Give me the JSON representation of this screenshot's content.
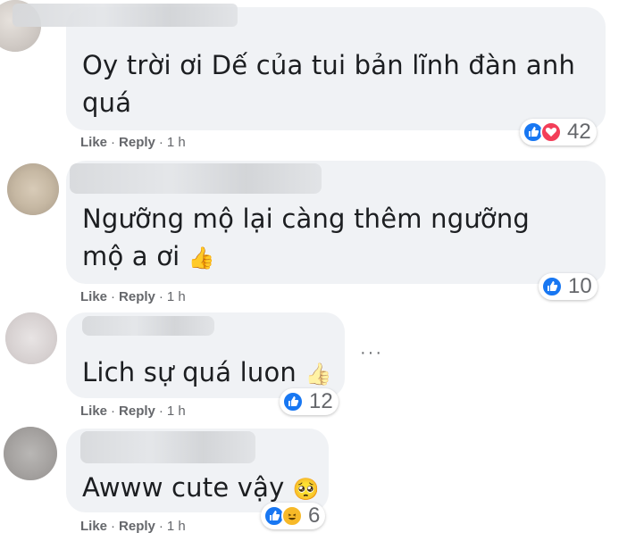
{
  "comments": [
    {
      "text_line1": "Oy trời ơi Dế của tui bản lĩnh đàn anh",
      "text_line2": "quá",
      "like": "Like",
      "reply": "Reply",
      "sep": "·",
      "time": "1 h",
      "reaction_count": "42",
      "reactions": [
        "like-icon",
        "love-icon"
      ]
    },
    {
      "text_line1": "Ngưỡng mộ lại càng thêm ngưỡng",
      "text_line2": "mộ a ơi",
      "emoji": "👍",
      "like": "Like",
      "reply": "Reply",
      "sep": "·",
      "time": "1 h",
      "reaction_count": "10",
      "reactions": [
        "like-icon"
      ]
    },
    {
      "text_line1": "Lich sự quá luon",
      "emoji": "👍",
      "like": "Like",
      "reply": "Reply",
      "sep": "·",
      "time": "1 h",
      "reaction_count": "12",
      "reactions": [
        "like-icon"
      ],
      "more": "···"
    },
    {
      "text_line1": "Awww cute vậy",
      "emoji": "🥺",
      "like": "Like",
      "reply": "Reply",
      "sep": "·",
      "time": "1 h",
      "reaction_count": "6",
      "reactions": [
        "like-icon",
        "haha-icon"
      ]
    }
  ]
}
